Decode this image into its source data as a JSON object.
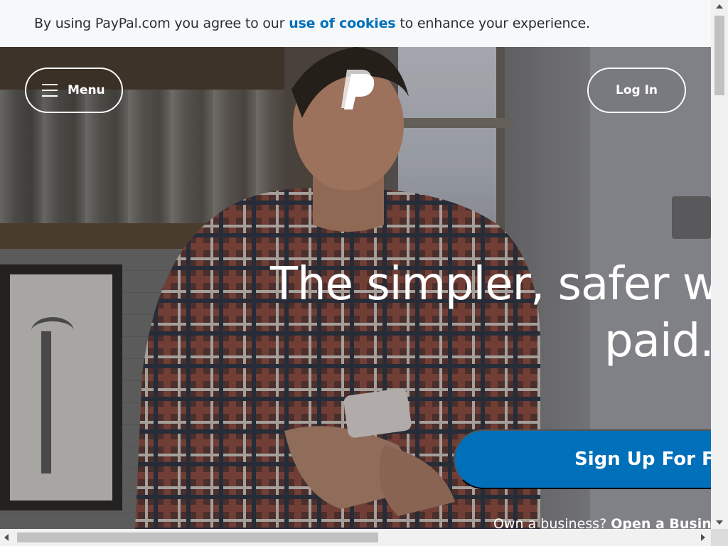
{
  "cookie_banner": {
    "text_before": "By using PayPal.com you agree to our",
    "link_label": "use of cookies",
    "text_after": "to enhance your experience."
  },
  "nav": {
    "menu_label": "Menu",
    "menu_icon": "hamburger-icon",
    "logo_icon": "paypal-logo-icon",
    "login_label": "Log In"
  },
  "hero": {
    "headline_line1": "The simpler, safer way",
    "headline_line2": "paid.",
    "signup_label": "Sign Up For Free",
    "business_prefix": "Own a business?",
    "business_link": "Open a Business Account"
  },
  "colors": {
    "brand_blue": "#0070ba",
    "banner_bg": "#f7f8f9",
    "text_dark": "#2c2e2f"
  }
}
